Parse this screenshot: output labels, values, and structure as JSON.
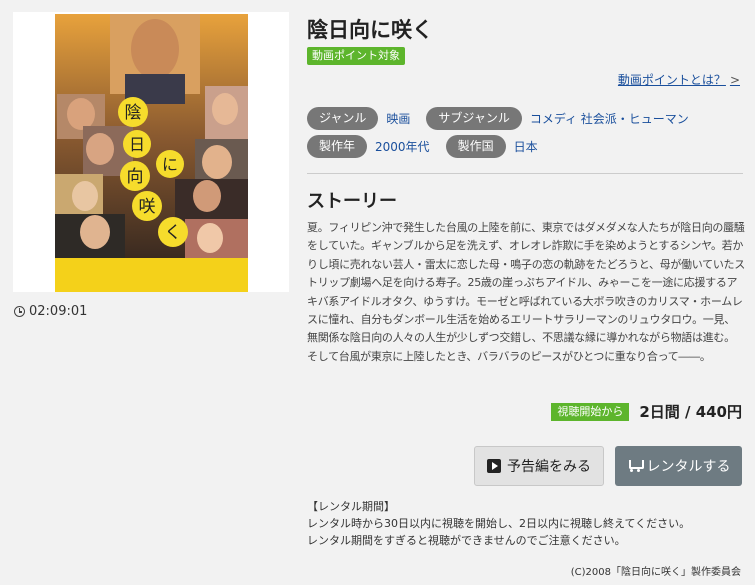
{
  "title": "陰日向に咲く",
  "badges": {
    "point": "動画ポイント対象",
    "start": "視聴開始から"
  },
  "point_link": {
    "label": "動画ポイントとは？",
    "chevron": ">"
  },
  "genre": {
    "label": "ジャンル",
    "value": "映画"
  },
  "subgenre": {
    "label": "サブジャンル",
    "value": "コメディ 社会派・ヒューマン"
  },
  "year": {
    "label": "製作年",
    "value": "2000年代"
  },
  "country": {
    "label": "製作国",
    "value": "日本"
  },
  "story": {
    "heading": "ストーリー",
    "text": "夏。フィリピン沖で発生した台風の上陸を前に、東京ではダメダメな人たちが陰日向の蜃騒をしていた。ギャンブルから足を洗えず、オレオレ詐欺に手を染めようとするシンヤ。若かりし頃に売れない芸人・雷太に恋した母・鳴子の恋の軌跡をたどろうと、母が働いていたストリップ劇場へ足を向ける寿子。25歳の崖っぷちアイドル、みゃーこを一途に応援するアキバ系アイドルオタク、ゆうすけ。モーゼと呼ばれている大ボラ吹きのカリスマ・ホームレスに憧れ、自分もダンボール生活を始めるエリートサラリーマンのリュウタロウ。一見、無関係な陰日向の人々の人生が少しずつ交錯し、不思議な縁に導かれながら物語は進む。そして台風が東京に上陸したとき、バラバラのピースがひとつに重なり合って――。"
  },
  "duration": "02:09:01",
  "price": "2日間 / 440円",
  "buttons": {
    "trailer": "予告編をみる",
    "rent": "レンタルする"
  },
  "rental_info": {
    "heading": "【レンタル期間】",
    "line1": "レンタル時から30日以内に視聴を開始し、2日以内に視聴し終えてください。",
    "line2": "レンタル期間をすぎると視聴ができませんのでご注意ください。"
  },
  "poster_title_chars": [
    "陰",
    "日",
    "向",
    "に",
    "咲",
    "く"
  ],
  "copyright": "(C)2008「陰日向に咲く」製作委員会",
  "colors": {
    "badge_green": "#5db52c",
    "tag_gray": "#777777",
    "rent_button": "#6e7b82",
    "link_blue": "#1a4f9c",
    "poster_yellow": "#f4d11a"
  },
  "icons": {
    "duration": "clock-icon",
    "trailer": "play-icon",
    "rent": "cart-icon"
  }
}
